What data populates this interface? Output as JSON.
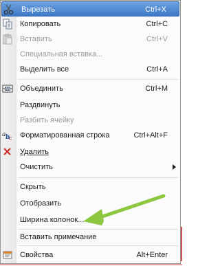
{
  "menu": {
    "items": [
      {
        "label": "Вырезать",
        "shortcut": "Ctrl+X"
      },
      {
        "label": "Копировать",
        "shortcut": "Ctrl+C"
      },
      {
        "label": "Вставить",
        "shortcut": "Ctrl+V"
      },
      {
        "label": "Специальная вставка...",
        "shortcut": ""
      },
      {
        "label": "Выделить все",
        "shortcut": "Ctrl+A"
      },
      {
        "label": "Объединить",
        "shortcut": "Ctrl+M"
      },
      {
        "label": "Раздвинуть",
        "shortcut": ""
      },
      {
        "label": "Разбить ячейку",
        "shortcut": ""
      },
      {
        "label": "Форматированная строка",
        "shortcut": "Ctrl+Alt+F"
      },
      {
        "label": "Удалить",
        "shortcut": ""
      },
      {
        "label": "Очистить",
        "shortcut": ""
      },
      {
        "label": "Скрыть",
        "shortcut": ""
      },
      {
        "label": "Отобразить",
        "shortcut": ""
      },
      {
        "label": "Ширина колонок...",
        "shortcut": ""
      },
      {
        "label": "Вставить примечание",
        "shortcut": ""
      },
      {
        "label": "Свойства",
        "shortcut": "Alt+Enter"
      }
    ]
  },
  "colors": {
    "highlight": "#4a86d0",
    "disabled": "#9a9a9a",
    "annotation_arrow": "#8dc63f"
  },
  "icons": [
    "scissors-icon",
    "copy-icon",
    "paste-icon",
    "merge-cells-icon",
    "formatted-string-icon",
    "delete-x-icon",
    "properties-icon"
  ]
}
